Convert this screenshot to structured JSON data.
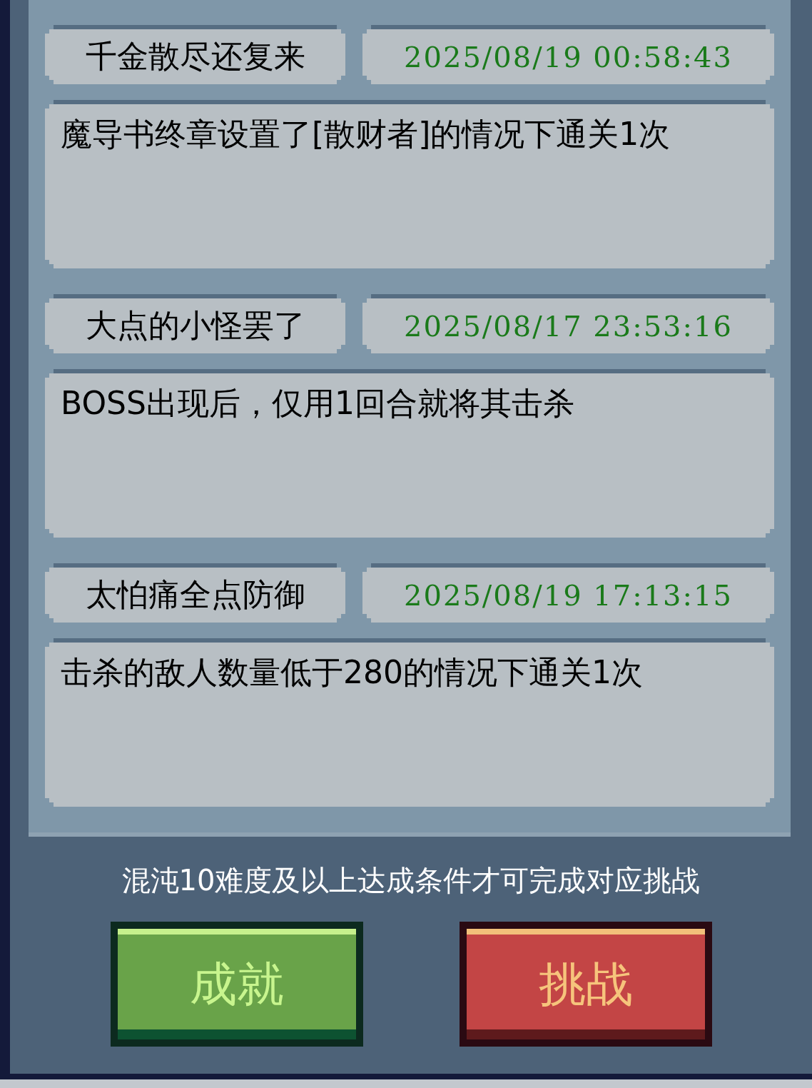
{
  "records": [
    {
      "name": "千金散尽还复来",
      "time": "2025/08/19 00:58:43",
      "description": "魔导书终章设置了[散财者]的情况下通关1次"
    },
    {
      "name": "大点的小怪罢了",
      "time": "2025/08/17 23:53:16",
      "description": "BOSS出现后，仅用1回合就将其击杀"
    },
    {
      "name": "太怕痛全点防御",
      "time": "2025/08/19 17:13:15",
      "description": "击杀的敌人数量低于280的情况下通关1次"
    }
  ],
  "note": "混沌10难度及以上达成条件才可完成对应挑战",
  "buttons": [
    {
      "label": "成就",
      "kind": "green"
    },
    {
      "label": "挑战",
      "kind": "red"
    }
  ]
}
